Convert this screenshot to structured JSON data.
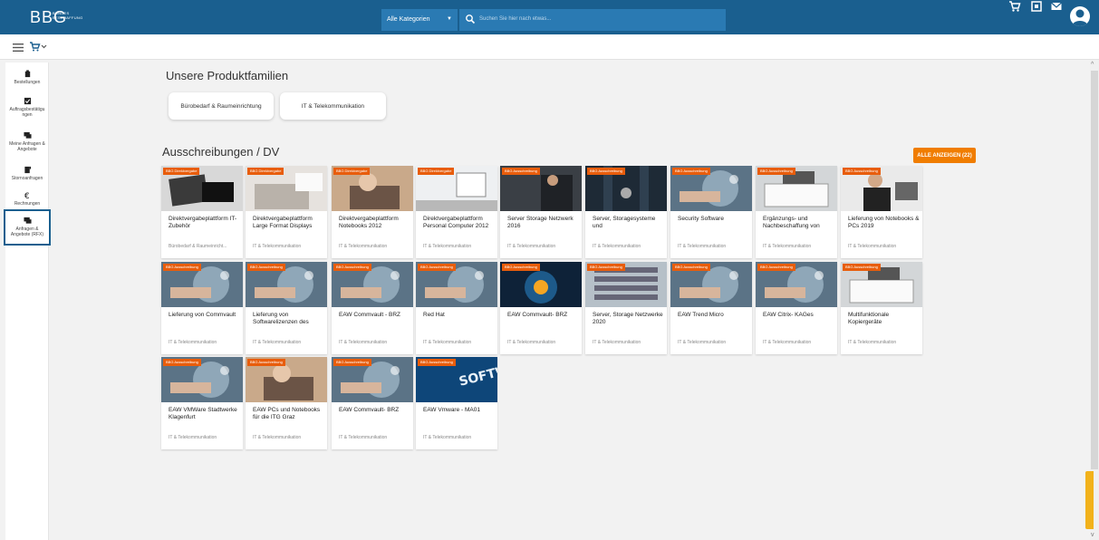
{
  "header": {
    "logo_text": "BBG",
    "logo_sub": "BUNDES BESCHAFFUNG",
    "category_select": "Alle Kategorien",
    "search_placeholder": "Suchen Sie hier nach etwas...",
    "brand_color": "#1a5f8f",
    "icons": [
      "cart-icon",
      "tasks-icon",
      "mail-icon",
      "user-avatar"
    ]
  },
  "sidebar": {
    "items": [
      {
        "label": "Bestellungen",
        "icon": "order-icon"
      },
      {
        "label": "Auftragsbestätigungen",
        "icon": "confirm-icon"
      },
      {
        "label": "Meine Anfragen & Angebote",
        "icon": "chat-icon"
      },
      {
        "label": "Stornoanfragen",
        "icon": "cancel-icon"
      },
      {
        "label": "Rechnungen",
        "icon": "euro-icon"
      },
      {
        "label": "Anfragen & Angebote (RFX)",
        "icon": "rfx-icon"
      }
    ]
  },
  "families": {
    "title": "Unsere Produktfamilien",
    "buttons": [
      "Bürobedarf & Raumeinrichtung",
      "IT & Telekommunikation"
    ]
  },
  "tenders": {
    "title": "Ausschreibungen / DV",
    "show_all": "ALLE ANZEIGEN (22)",
    "accent_color": "#f07d00",
    "cards": [
      {
        "badge": "BBG Direktvergabe",
        "title": "Direktvergabeplattform IT-Zubehör",
        "category": "Bürobedarf & Raumeinricht...",
        "img": "cards"
      },
      {
        "badge": "BBG Direktvergabe",
        "title": "Direktvergabeplattform Large Format Displays",
        "category": "IT & Telekommunikation",
        "img": "laptop"
      },
      {
        "badge": "BBG Direktvergabe",
        "title": "Direktvergabeplattform Notebooks 2012",
        "category": "IT & Telekommunikation",
        "img": "hands"
      },
      {
        "badge": "BBG Direktvergabe",
        "title": "Direktvergabeplattform Personal Computer 2012",
        "category": "IT & Telekommunikation",
        "img": "desk"
      },
      {
        "badge": "BBG Ausschreibung",
        "title": "Server Storage Netzwerk 2016",
        "category": "IT & Telekommunikation",
        "img": "person"
      },
      {
        "badge": "BBG Ausschreibung",
        "title": "Server, Storagesysteme und",
        "category": "IT & Telekommunikation",
        "img": "server"
      },
      {
        "badge": "BBG Ausschreibung",
        "title": "Security Software",
        "category": "IT & Telekommunikation",
        "img": "hand"
      },
      {
        "badge": "BBG Ausschreibung",
        "title": "Ergänzungs- und Nachbeschaffung von",
        "category": "IT & Telekommunikation",
        "img": "printer"
      },
      {
        "badge": "BBG Ausschreibung",
        "title": "Lieferung von Notebooks & PCs 2019",
        "category": "IT & Telekommunikation",
        "img": "woman"
      },
      {
        "badge": "BBG Ausschreibung",
        "title": "Lieferung von Commvault",
        "category": "IT & Telekommunikation",
        "img": "hand"
      },
      {
        "badge": "BBG Ausschreibung",
        "title": "Lieferung von Softwarelizenzen des",
        "category": "IT & Telekommunikation",
        "img": "hand"
      },
      {
        "badge": "BBG Ausschreibung",
        "title": "EAW Commvault - BRZ",
        "category": "IT & Telekommunikation",
        "img": "hand"
      },
      {
        "badge": "BBG Ausschreibung",
        "title": "Red Hat",
        "category": "IT & Telekommunikation",
        "img": "hand"
      },
      {
        "badge": "BBG Ausschreibung",
        "title": "EAW Commvault- BRZ",
        "category": "IT & Telekommunikation",
        "img": "glow"
      },
      {
        "badge": "BBG Ausschreibung",
        "title": "Server, Storage Netzwerke 2020",
        "category": "IT & Telekommunikation",
        "img": "rack"
      },
      {
        "badge": "BBG Ausschreibung",
        "title": "EAW Trend Micro",
        "category": "IT & Telekommunikation",
        "img": "hand"
      },
      {
        "badge": "BBG Ausschreibung",
        "title": "EAW Citrix- KAGes",
        "category": "IT & Telekommunikation",
        "img": "hand"
      },
      {
        "badge": "BBG Ausschreibung",
        "title": "Multifunktionale Kopiergeräte",
        "category": "IT & Telekommunikation",
        "img": "printer"
      },
      {
        "badge": "BBG Ausschreibung",
        "title": "EAW VMWare Stadtwerke Klagenfurt",
        "category": "IT & Telekommunikation",
        "img": "hand"
      },
      {
        "badge": "BBG Ausschreibung",
        "title": "EAW PCs und Notebooks für die ITG Graz",
        "category": "IT & Telekommunikation",
        "img": "hands"
      },
      {
        "badge": "BBG Ausschreibung",
        "title": "EAW Commvault- BRZ",
        "category": "IT & Telekommunikation",
        "img": "hand"
      },
      {
        "badge": "BBG Ausschreibung",
        "title": "EAW Vmware - MA01",
        "category": "IT & Telekommunikation",
        "img": "software",
        "img_text": "SOFTWARE"
      }
    ]
  }
}
